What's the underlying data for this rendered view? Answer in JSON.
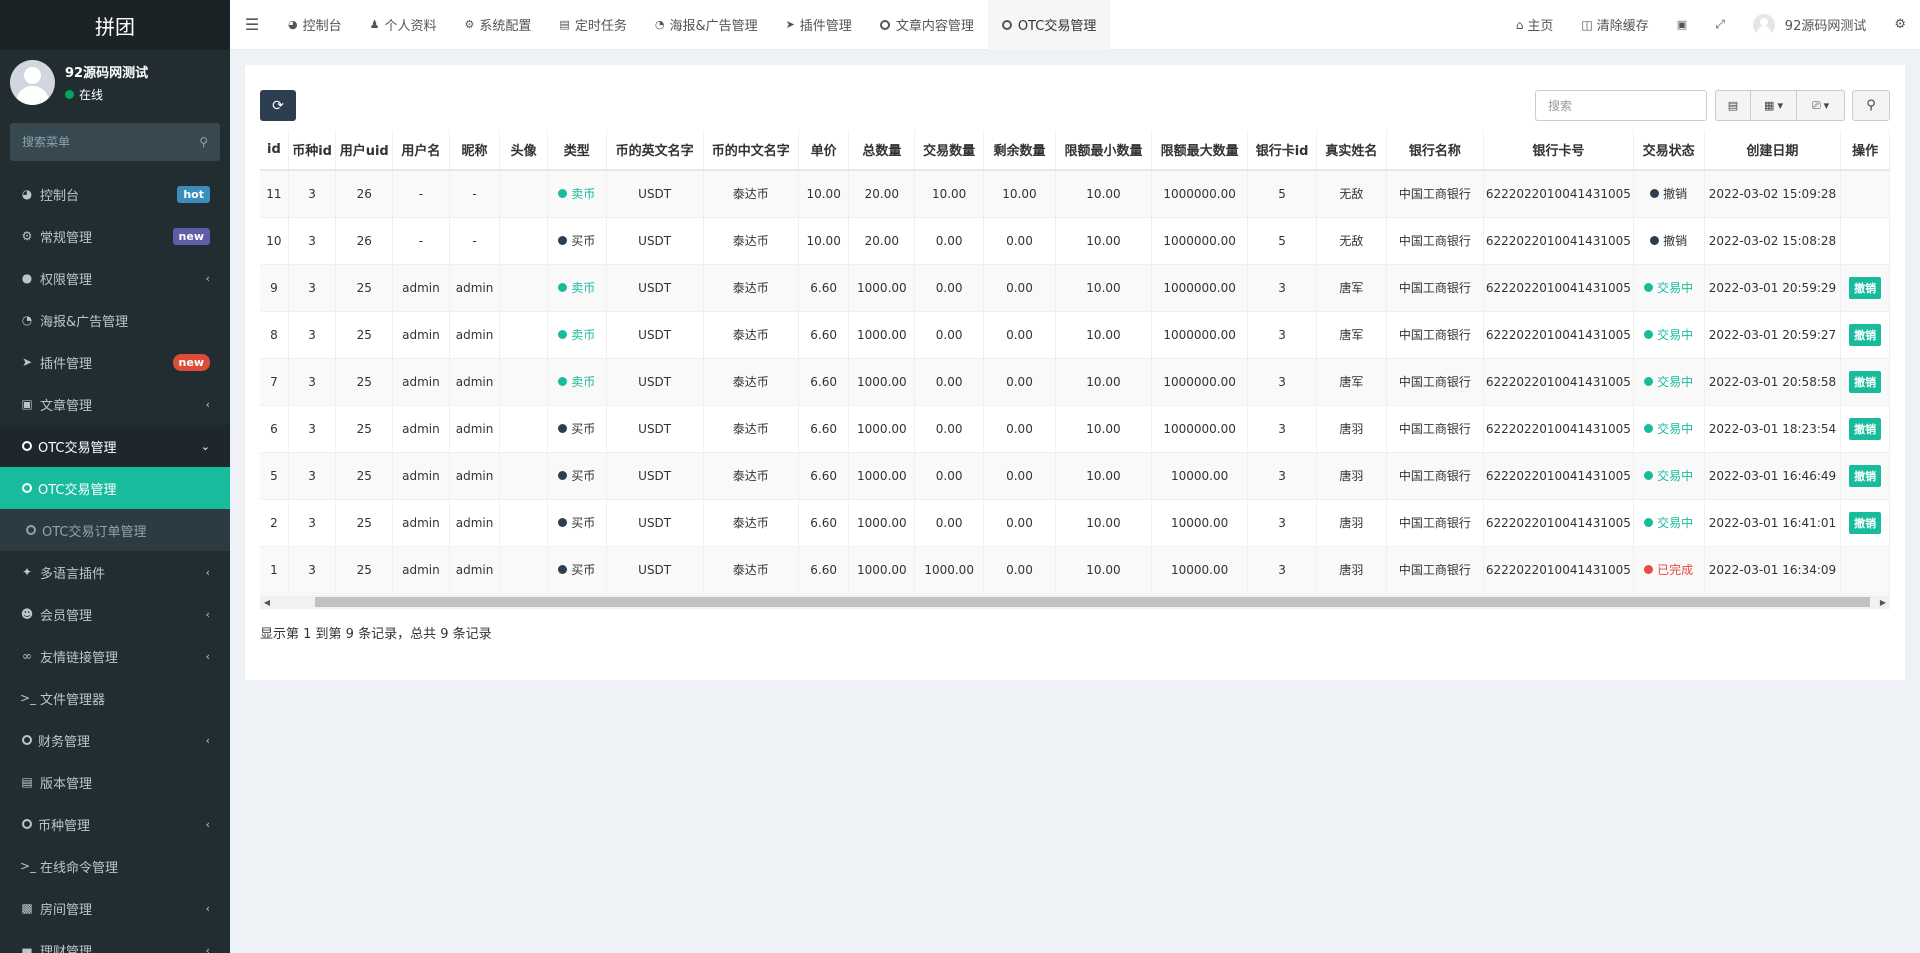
{
  "sidebar": {
    "logo": "拼团",
    "user": {
      "name": "92源码网测试",
      "status": "在线",
      "status_color": "#00a65a"
    },
    "search_placeholder": "搜索菜单",
    "items": [
      {
        "label": "控制台",
        "icon": "dashboard-icon",
        "badge": "hot"
      },
      {
        "label": "常规管理",
        "icon": "cogs-icon",
        "badge": "new"
      },
      {
        "label": "权限管理",
        "icon": "group-icon"
      },
      {
        "label": "海报&广告管理",
        "icon": "pie-chart-icon"
      },
      {
        "label": "插件管理",
        "icon": "rocket-icon",
        "badge": "new"
      },
      {
        "label": "文章管理",
        "icon": "folder-icon"
      },
      {
        "label": "OTC交易管理",
        "icon": "circle-icon"
      },
      {
        "label": "OTC交易管理",
        "icon": "circle-icon"
      },
      {
        "label": "OTC交易订单管理",
        "icon": "circle-icon"
      },
      {
        "label": "多语言插件",
        "icon": "magic-icon"
      },
      {
        "label": "会员管理",
        "icon": "user-circle-icon"
      },
      {
        "label": "友情链接管理",
        "icon": "link-icon"
      },
      {
        "label": "文件管理器",
        "icon": "terminal-icon"
      },
      {
        "label": "财务管理",
        "icon": "circle-icon"
      },
      {
        "label": "版本管理",
        "icon": "file-icon"
      },
      {
        "label": "币种管理",
        "icon": "circle-icon"
      },
      {
        "label": "在线命令管理",
        "icon": "terminal-icon"
      },
      {
        "label": "房间管理",
        "icon": "industry-icon"
      },
      {
        "label": "理财管理",
        "icon": "money-icon"
      }
    ]
  },
  "topbar": {
    "tabs": [
      {
        "label": "控制台",
        "icon": "dashboard-icon"
      },
      {
        "label": "个人资料",
        "icon": "user-icon"
      },
      {
        "label": "系统配置",
        "icon": "cog-icon"
      },
      {
        "label": "定时任务",
        "icon": "tasks-icon"
      },
      {
        "label": "海报&广告管理",
        "icon": "pie-chart-icon"
      },
      {
        "label": "插件管理",
        "icon": "rocket-icon"
      },
      {
        "label": "文章内容管理",
        "icon": "circle-icon"
      },
      {
        "label": "OTC交易管理",
        "icon": "circle-icon"
      }
    ],
    "home": "主页",
    "clear_cache": "清除缓存",
    "username": "92源码网测试"
  },
  "toolbar": {
    "search_placeholder": "搜索"
  },
  "table": {
    "columns": [
      "id",
      "币种id",
      "用户uid",
      "用户名",
      "昵称",
      "头像",
      "类型",
      "币的英文名字",
      "币的中文名字",
      "单价",
      "总数量",
      "交易数量",
      "剩余数量",
      "限额最小数量",
      "限额最大数量",
      "银行卡id",
      "真实姓名",
      "银行名称",
      "银行卡号",
      "交易状态",
      "创建日期",
      "操作"
    ],
    "rows": [
      {
        "id": "11",
        "coin_id": "3",
        "uid": "26",
        "username": "-",
        "nickname": "-",
        "type": "卖币",
        "type_color": "#18bc9c",
        "en": "USDT",
        "cn": "泰达币",
        "price": "10.00",
        "total": "20.00",
        "traded": "10.00",
        "remain": "10.00",
        "min": "10.00",
        "max": "1000000.00",
        "card_id": "5",
        "realname": "无敌",
        "bank": "中国工商银行",
        "card_no": "6222022010041431005",
        "status": "撤销",
        "status_color": "#2c3e50",
        "date": "2022-03-02 15:09:28",
        "op": ""
      },
      {
        "id": "10",
        "coin_id": "3",
        "uid": "26",
        "username": "-",
        "nickname": "-",
        "type": "买币",
        "type_color": "#2c3e50",
        "en": "USDT",
        "cn": "泰达币",
        "price": "10.00",
        "total": "20.00",
        "traded": "0.00",
        "remain": "0.00",
        "min": "10.00",
        "max": "1000000.00",
        "card_id": "5",
        "realname": "无敌",
        "bank": "中国工商银行",
        "card_no": "6222022010041431005",
        "status": "撤销",
        "status_color": "#2c3e50",
        "date": "2022-03-02 15:08:28",
        "op": ""
      },
      {
        "id": "9",
        "coin_id": "3",
        "uid": "25",
        "username": "admin",
        "nickname": "admin",
        "type": "卖币",
        "type_color": "#18bc9c",
        "en": "USDT",
        "cn": "泰达币",
        "price": "6.60",
        "total": "1000.00",
        "traded": "0.00",
        "remain": "0.00",
        "min": "10.00",
        "max": "1000000.00",
        "card_id": "3",
        "realname": "唐军",
        "bank": "中国工商银行",
        "card_no": "6222022010041431005",
        "status": "交易中",
        "status_color": "#18bc9c",
        "date": "2022-03-01 20:59:29",
        "op": "撤销"
      },
      {
        "id": "8",
        "coin_id": "3",
        "uid": "25",
        "username": "admin",
        "nickname": "admin",
        "type": "卖币",
        "type_color": "#18bc9c",
        "en": "USDT",
        "cn": "泰达币",
        "price": "6.60",
        "total": "1000.00",
        "traded": "0.00",
        "remain": "0.00",
        "min": "10.00",
        "max": "1000000.00",
        "card_id": "3",
        "realname": "唐军",
        "bank": "中国工商银行",
        "card_no": "6222022010041431005",
        "status": "交易中",
        "status_color": "#18bc9c",
        "date": "2022-03-01 20:59:27",
        "op": "撤销"
      },
      {
        "id": "7",
        "coin_id": "3",
        "uid": "25",
        "username": "admin",
        "nickname": "admin",
        "type": "卖币",
        "type_color": "#18bc9c",
        "en": "USDT",
        "cn": "泰达币",
        "price": "6.60",
        "total": "1000.00",
        "traded": "0.00",
        "remain": "0.00",
        "min": "10.00",
        "max": "1000000.00",
        "card_id": "3",
        "realname": "唐军",
        "bank": "中国工商银行",
        "card_no": "6222022010041431005",
        "status": "交易中",
        "status_color": "#18bc9c",
        "date": "2022-03-01 20:58:58",
        "op": "撤销"
      },
      {
        "id": "6",
        "coin_id": "3",
        "uid": "25",
        "username": "admin",
        "nickname": "admin",
        "type": "买币",
        "type_color": "#2c3e50",
        "en": "USDT",
        "cn": "泰达币",
        "price": "6.60",
        "total": "1000.00",
        "traded": "0.00",
        "remain": "0.00",
        "min": "10.00",
        "max": "1000000.00",
        "card_id": "3",
        "realname": "唐羽",
        "bank": "中国工商银行",
        "card_no": "6222022010041431005",
        "status": "交易中",
        "status_color": "#18bc9c",
        "date": "2022-03-01 18:23:54",
        "op": "撤销"
      },
      {
        "id": "5",
        "coin_id": "3",
        "uid": "25",
        "username": "admin",
        "nickname": "admin",
        "type": "买币",
        "type_color": "#2c3e50",
        "en": "USDT",
        "cn": "泰达币",
        "price": "6.60",
        "total": "1000.00",
        "traded": "0.00",
        "remain": "0.00",
        "min": "10.00",
        "max": "10000.00",
        "card_id": "3",
        "realname": "唐羽",
        "bank": "中国工商银行",
        "card_no": "6222022010041431005",
        "status": "交易中",
        "status_color": "#18bc9c",
        "date": "2022-03-01 16:46:49",
        "op": "撤销"
      },
      {
        "id": "2",
        "coin_id": "3",
        "uid": "25",
        "username": "admin",
        "nickname": "admin",
        "type": "买币",
        "type_color": "#2c3e50",
        "en": "USDT",
        "cn": "泰达币",
        "price": "6.60",
        "total": "1000.00",
        "traded": "0.00",
        "remain": "0.00",
        "min": "10.00",
        "max": "10000.00",
        "card_id": "3",
        "realname": "唐羽",
        "bank": "中国工商银行",
        "card_no": "6222022010041431005",
        "status": "交易中",
        "status_color": "#18bc9c",
        "date": "2022-03-01 16:41:01",
        "op": "撤销"
      },
      {
        "id": "1",
        "coin_id": "3",
        "uid": "25",
        "username": "admin",
        "nickname": "admin",
        "type": "买币",
        "type_color": "#2c3e50",
        "en": "USDT",
        "cn": "泰达币",
        "price": "6.60",
        "total": "1000.00",
        "traded": "1000.00",
        "remain": "0.00",
        "min": "10.00",
        "max": "10000.00",
        "card_id": "3",
        "realname": "唐羽",
        "bank": "中国工商银行",
        "card_no": "6222022010041431005",
        "status": "已完成",
        "status_color": "#e74c3c",
        "date": "2022-03-01 16:34:09",
        "op": ""
      }
    ]
  },
  "pagination": {
    "info": "显示第 1 到第 9 条记录，总共 9 条记录"
  },
  "colors": {
    "accent": "#18bc9c",
    "sidebar_bg": "#222d32",
    "dark_button": "#2c3e50"
  }
}
